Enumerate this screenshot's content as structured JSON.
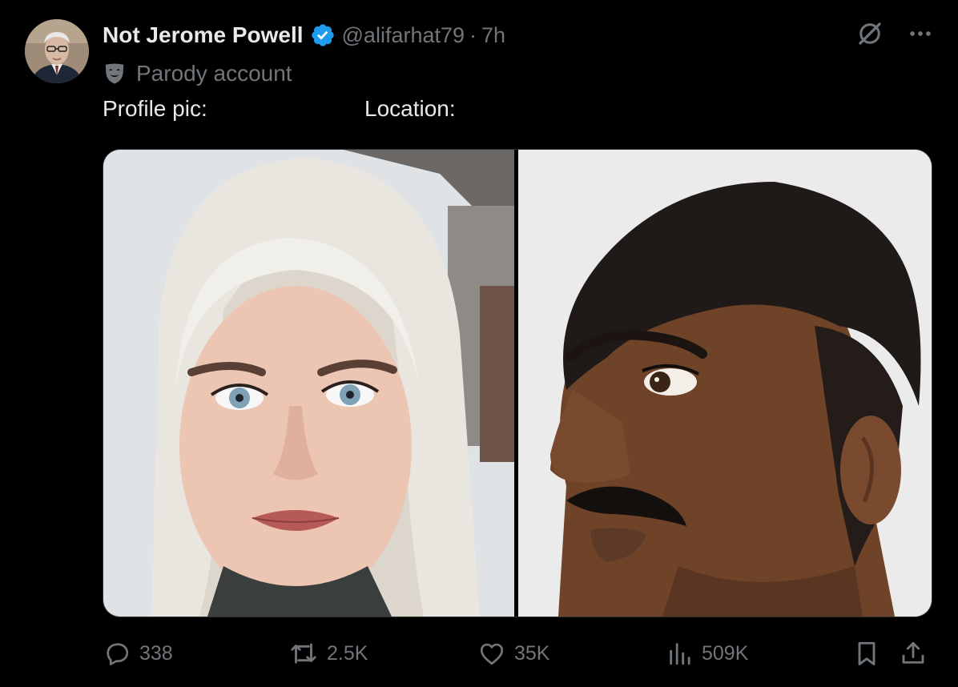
{
  "author": {
    "display_name": "Not Jerome Powell",
    "handle": "@alifarhat79",
    "separator": "·",
    "time": "7h",
    "parody_label": "Parody account",
    "verified": true,
    "verified_color": "#1d9bf0"
  },
  "tweet": {
    "line_left": "Profile pic:",
    "line_right": "Location:"
  },
  "media": {
    "left_image": "portrait of woman with platinum blonde hair",
    "right_image": "side profile of man with dark hair and mustache"
  },
  "actions": {
    "replies": "338",
    "reposts": "2.5K",
    "likes": "35K",
    "views": "509K"
  },
  "icons": {
    "top_right": [
      "grok-icon",
      "more-icon"
    ],
    "bar": [
      "reply-icon",
      "repost-icon",
      "like-icon",
      "views-icon",
      "bookmark-icon",
      "share-icon"
    ]
  },
  "colors": {
    "background": "#000000",
    "text_primary": "#e7e9ea",
    "text_secondary": "#71767b",
    "accent": "#1d9bf0"
  }
}
